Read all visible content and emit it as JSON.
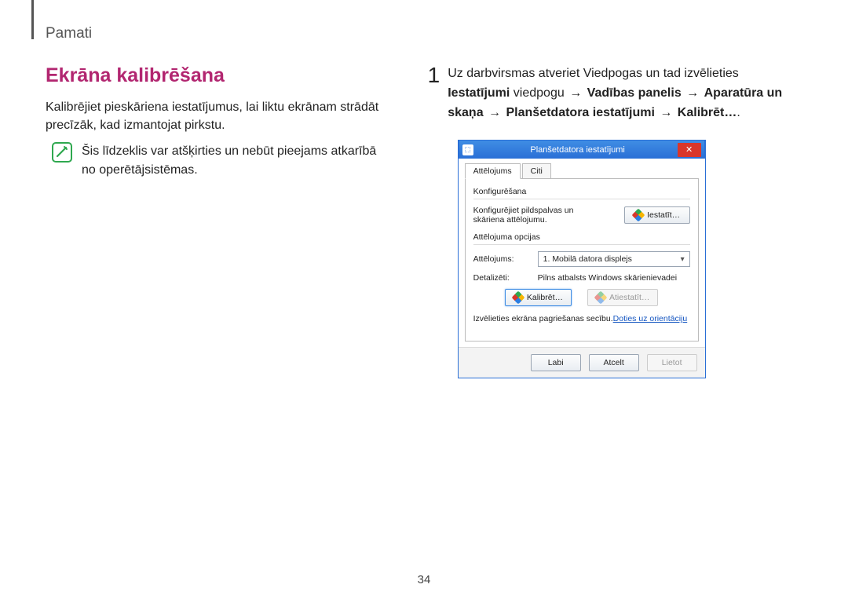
{
  "header": "Pamati",
  "section_title": "Ekrāna kalibrēšana",
  "intro": "Kalibrējiet pieskāriena iestatījumus, lai liktu ekrānam strādāt precīzāk, kad izmantojat pirkstu.",
  "note": "Šis līdzeklis var atšķirties un nebūt pieejams atkarībā no operētājsistēmas.",
  "step": {
    "num": "1",
    "pre": "Uz darbvirsmas atveriet Viedpogas un tad izvēlieties ",
    "b1": "Iestatījumi",
    "mid1": " viedpogu ",
    "b2": "Vadības panelis",
    "b3": "Aparatūra un skaņa",
    "b4": "Planšetdatora iestatījumi",
    "b5": "Kalibrēt…",
    "arrow": "→"
  },
  "dialog": {
    "title": "Planšetdatora iestatījumi",
    "tabs": {
      "t1": "Attēlojums",
      "t2": "Citi"
    },
    "group_config": "Konfigurēšana",
    "config_text": "Konfigurējiet pildspalvas un skāriena attēlojumu.",
    "btn_setup": "Iestatīt…",
    "group_display": "Attēlojuma opcijas",
    "label_display": "Attēlojums:",
    "select_value": "1. Mobilā datora displejs",
    "label_detail": "Detalizēti:",
    "detail_text": "Pilns atbalsts Windows skārienievadei",
    "btn_calibrate": "Kalibrēt…",
    "btn_reset": "Atiestatīt…",
    "rotate_pre": "Izvēlieties ekrāna pagriešanas secību.",
    "rotate_link": "Doties uz orientāciju",
    "footer": {
      "ok": "Labi",
      "cancel": "Atcelt",
      "apply": "Lietot"
    }
  },
  "page_number": "34"
}
